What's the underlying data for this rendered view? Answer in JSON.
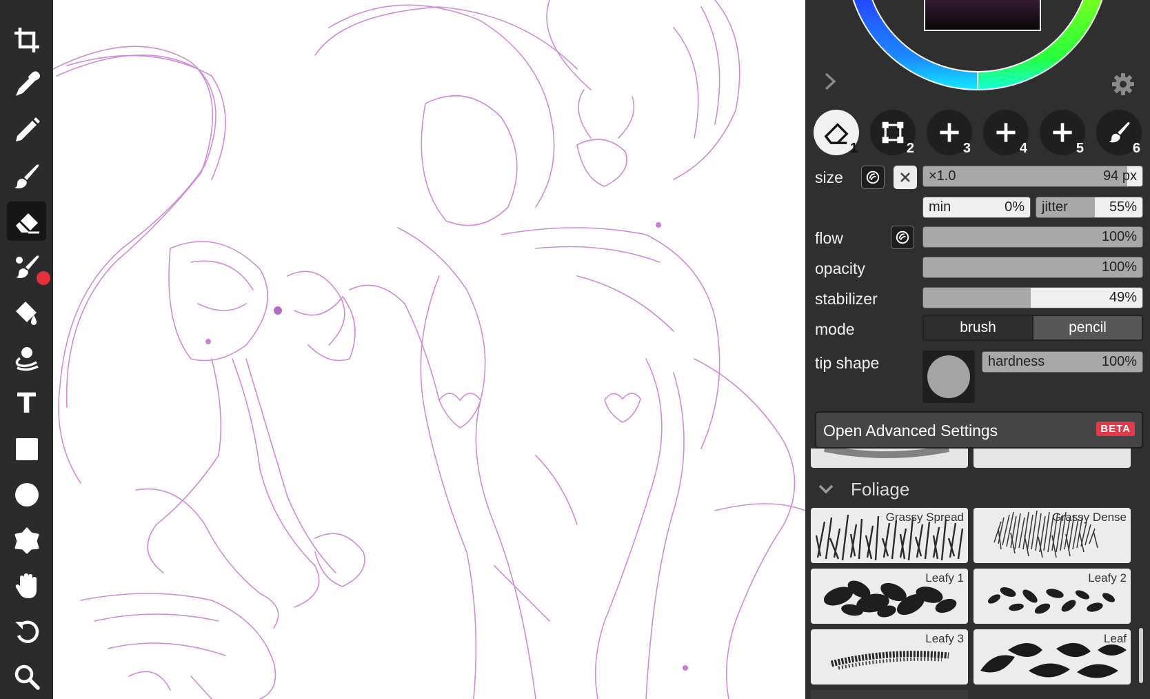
{
  "toolbar": {
    "tools": [
      {
        "name": "crop-icon"
      },
      {
        "name": "eyedropper-icon"
      },
      {
        "name": "pencil-icon"
      },
      {
        "name": "brush-icon"
      },
      {
        "name": "eraser-icon",
        "active": true
      },
      {
        "name": "blend-brush-icon"
      },
      {
        "name": "fill-bucket-icon"
      },
      {
        "name": "smudge-icon"
      },
      {
        "name": "text-icon",
        "glyph": "T"
      },
      {
        "name": "rectangle-icon"
      },
      {
        "name": "ellipse-icon"
      },
      {
        "name": "shape-icon"
      },
      {
        "name": "hand-icon"
      },
      {
        "name": "undo-icon"
      },
      {
        "name": "zoom-icon"
      }
    ]
  },
  "colors": {
    "accent": "#e23a48",
    "sketch_stroke": "#c97fd2",
    "panel_bg": "#2f2f2f"
  },
  "slots": [
    {
      "num": "1",
      "icon": "eraser-icon",
      "active": true
    },
    {
      "num": "2",
      "icon": "selection-icon"
    },
    {
      "num": "3",
      "icon": "plus-icon"
    },
    {
      "num": "4",
      "icon": "plus-icon"
    },
    {
      "num": "5",
      "icon": "plus-icon"
    },
    {
      "num": "6",
      "icon": "brush-icon"
    }
  ],
  "settings": {
    "size_label": "size",
    "size_multiplier": "×1.0",
    "size_value": "94 px",
    "size_fill": 0.93,
    "min_label": "min",
    "min_value": "0%",
    "jitter_label": "jitter",
    "jitter_value": "55%",
    "jitter_fill": 0.55,
    "flow_label": "flow",
    "flow_value": "100%",
    "flow_fill": 1.0,
    "opacity_label": "opacity",
    "opacity_value": "100%",
    "opacity_fill": 1.0,
    "stabilizer_label": "stabilizer",
    "stabilizer_value": "49%",
    "stabilizer_fill": 0.49,
    "mode_label": "mode",
    "mode_brush": "brush",
    "mode_pencil": "pencil",
    "mode_selected": "pencil",
    "tip_label": "tip shape",
    "hardness_label": "hardness",
    "hardness_value": "100%",
    "hardness_fill": 1.0,
    "advanced_label": "Open Advanced Settings",
    "beta_label": "BETA"
  },
  "brushes": {
    "category": "Foliage",
    "items": [
      {
        "name": "Grassy Spread"
      },
      {
        "name": "Grassy Dense"
      },
      {
        "name": "Leafy 1"
      },
      {
        "name": "Leafy 2"
      },
      {
        "name": "Leafy 3"
      },
      {
        "name": "Leaf"
      }
    ]
  }
}
